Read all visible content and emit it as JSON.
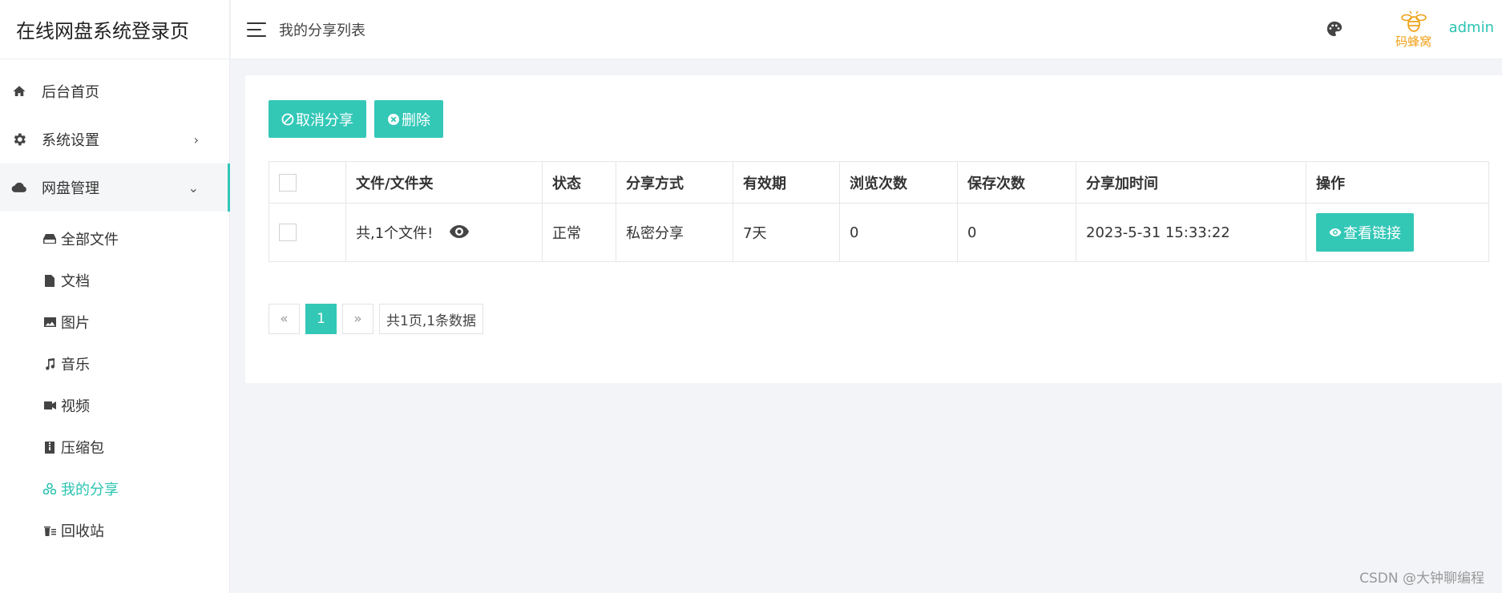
{
  "sidebar": {
    "brand": "在线网盘系统登录页",
    "items": [
      {
        "label": "后台首页",
        "icon": "home-icon"
      },
      {
        "label": "系统设置",
        "icon": "gear-icon",
        "caret": "›"
      },
      {
        "label": "网盘管理",
        "icon": "cloud-icon",
        "caret": "⌄"
      }
    ],
    "subitems": [
      {
        "label": "全部文件",
        "icon": "drive-icon"
      },
      {
        "label": "文档",
        "icon": "file-icon"
      },
      {
        "label": "图片",
        "icon": "image-icon"
      },
      {
        "label": "音乐",
        "icon": "music-icon"
      },
      {
        "label": "视频",
        "icon": "video-icon"
      },
      {
        "label": "压缩包",
        "icon": "archive-icon"
      },
      {
        "label": "我的分享",
        "icon": "share-icon",
        "active": true
      },
      {
        "label": "回收站",
        "icon": "trash-icon"
      }
    ]
  },
  "header": {
    "breadcrumb": "我的分享列表",
    "logo_text": "码蜂窝",
    "user": "admin"
  },
  "toolbar": {
    "cancel_share": "取消分享",
    "delete": "删除"
  },
  "table": {
    "headers": [
      "文件/文件夹",
      "状态",
      "分享方式",
      "有效期",
      "浏览次数",
      "保存次数",
      "分享加时间",
      "操作"
    ],
    "rows": [
      {
        "name": "共,1个文件!",
        "status": "正常",
        "method": "私密分享",
        "validity": "7天",
        "views": "0",
        "saves": "0",
        "time": "2023-5-31 15:33:22",
        "action": "查看链接"
      }
    ]
  },
  "pagination": {
    "prev": "«",
    "current": "1",
    "next": "»",
    "summary": "共1页,1条数据"
  },
  "watermark": "CSDN @大钟聊编程",
  "colors": {
    "accent": "#33c7b6",
    "green_text": "#2bbf84",
    "logo_orange": "#f0a21a"
  }
}
